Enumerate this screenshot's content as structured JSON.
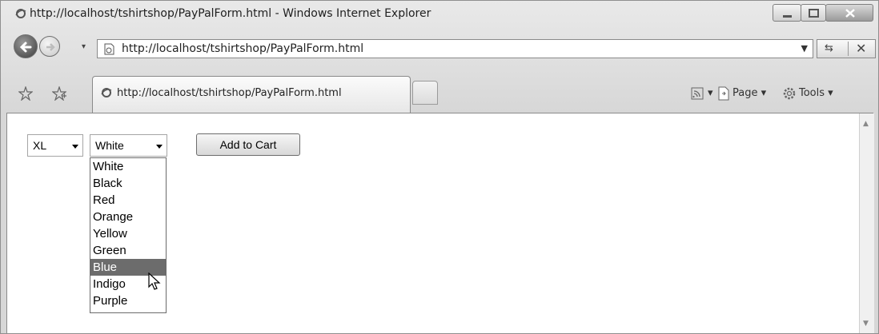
{
  "window": {
    "title": "http://localhost/tshirtshop/PayPalForm.html - Windows Internet Explorer"
  },
  "address_bar": {
    "url": "http://localhost/tshirtshop/PayPalForm.html"
  },
  "tab": {
    "label": "http://localhost/tshirtshop/PayPalForm.html"
  },
  "command_bar": {
    "page_label": "Page",
    "tools_label": "Tools"
  },
  "form": {
    "size_value": "XL",
    "color_value": "White",
    "add_to_cart_label": "Add to Cart",
    "color_options": [
      "White",
      "Black",
      "Red",
      "Orange",
      "Yellow",
      "Green",
      "Blue",
      "Indigo",
      "Purple"
    ],
    "highlighted_option": "Blue"
  },
  "icons": [
    "ie-icon",
    "back-icon",
    "forward-icon",
    "page-icon",
    "refresh-icon",
    "stop-icon",
    "favorites-star-icon",
    "add-favorites-icon",
    "rss-feed-icon",
    "page-menu-icon",
    "tools-gear-icon",
    "mouse-cursor-icon"
  ]
}
